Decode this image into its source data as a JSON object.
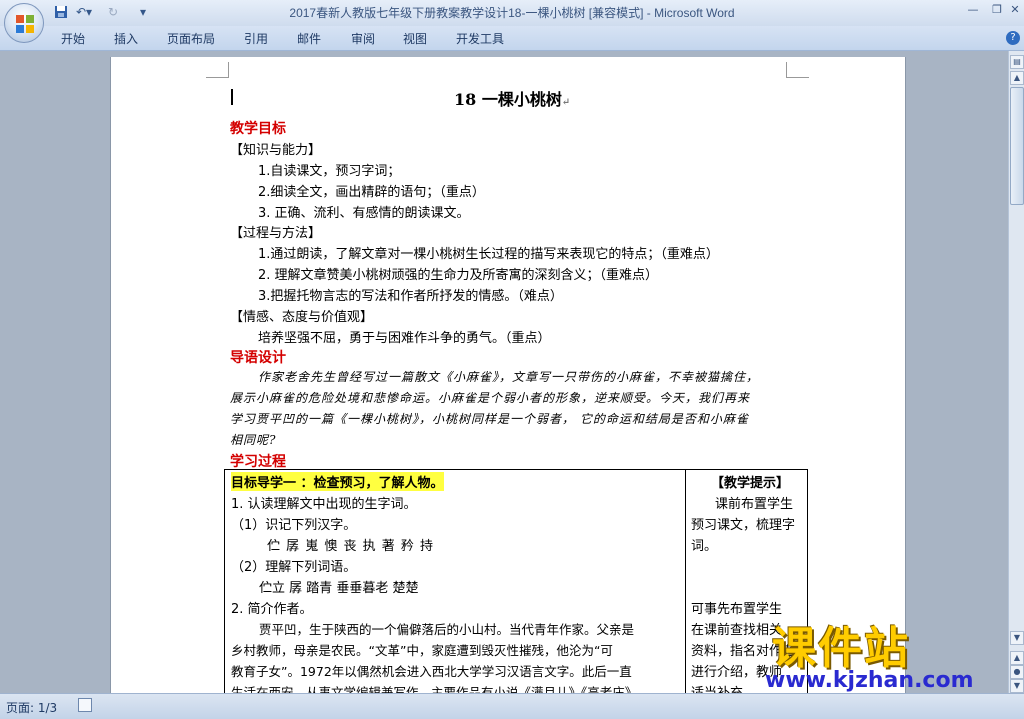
{
  "window": {
    "title": "2017春新人教版七年级下册教案教学设计18-一棵小桃树 [兼容模式] - Microsoft Word"
  },
  "ribbon": {
    "tabs": [
      "开始",
      "插入",
      "页面布局",
      "引用",
      "邮件",
      "审阅",
      "视图",
      "开发工具"
    ]
  },
  "document": {
    "title": "18 一棵小桃树",
    "sections": {
      "goals_heading": "教学目标",
      "knowledge_heading": "【知识与能力】",
      "knowledge_items": [
        "1.自读课文，预习字词；",
        "2.细读全文，画出精辟的语句；（重点）",
        "3. 正确、流利、有感情的朗读课文。"
      ],
      "process_heading": "【过程与方法】",
      "process_items": [
        "1.通过朗读，了解文章对一棵小桃树生长过程的描写来表现它的特点；（重难点）",
        "2. 理解文章赞美小桃树顽强的生命力及所寄寓的深刻含义；（重难点）",
        "3.把握托物言志的写法和作者所抒发的情感。（难点）"
      ],
      "emotion_heading": "【情感、态度与价值观】",
      "emotion_item": "培养坚强不屈，勇于与困难作斗争的勇气。（重点）",
      "intro_heading": "导语设计",
      "intro_lines": [
        "作家老舍先生曾经写过一篇散文《小麻雀》，文章写一只带伤的小麻雀，不幸被猫擒住，",
        "展示小麻雀的危险处境和悲惨命运。小麻雀是个弱小者的形象，逆来顺受。今天，我们再来",
        "学习贾平凹的一篇《一棵小桃树》，小桃树同样是一个弱者，  它的命运和结局是否和小麻雀",
        "相同呢?"
      ],
      "process2_heading": "学习过程"
    },
    "table": {
      "left_heading": "目标导学一 ：检查预习，了解人物。",
      "left_lines": [
        "1. 认读理解文中出现的生字词。",
        "（1）识记下列汉字。",
        "伫 孱 嵬 懊 丧 执 著 矜 持",
        "（2）理解下列词语。",
        "伫立   孱   踏青  垂垂暮老  楚楚",
        "2. 简介作者。",
        "贾平凹，生于陕西的一个偏僻落后的小山村。当代青年作家。父亲是",
        "乡村教师，母亲是农民。“文革”中，家庭遭到毁灭性摧残，他沦为“可",
        "教育子女”。1972年以偶然机会进入西北大学学习汉语言文字。此后一直",
        "生活在西安，从事文学编辑兼写作。主要作品有小说《满月儿》《高老庄》"
      ],
      "right_heading": "【教学提示】",
      "right_lines": [
        "课前布置学生",
        "预习课文，梳理字",
        "词。",
        "",
        "",
        "可事先布置学生",
        "在课前查找相关",
        "资料，指名对作者",
        "进行介绍，教师",
        "适当补充。"
      ]
    }
  },
  "status": {
    "page": "页面: 1/3"
  },
  "watermark": {
    "text": "课件站",
    "url": "www.kjzhan.com"
  }
}
